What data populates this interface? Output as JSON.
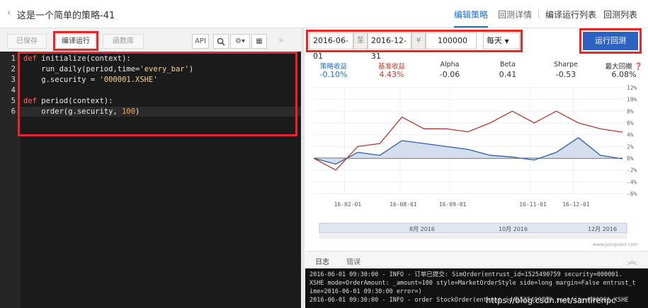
{
  "header": {
    "back": "‹",
    "title": "这是一个简单的策略-41",
    "nav": [
      "编辑策略",
      "回测详情",
      "编译运行列表",
      "回测列表"
    ]
  },
  "toolbar": {
    "tabs": [
      "已保存",
      "编译运行",
      "函数库"
    ],
    "api": "API"
  },
  "editor": {
    "lines": [
      [
        {
          "t": "def ",
          "c": "kw"
        },
        {
          "t": "initialize(context):",
          "c": ""
        }
      ],
      [
        {
          "t": "    run_daily(period,time=",
          "c": ""
        },
        {
          "t": "'every_bar'",
          "c": "str"
        },
        {
          "t": ")",
          "c": ""
        }
      ],
      [
        {
          "t": "    g.security = ",
          "c": ""
        },
        {
          "t": "'000001.XSHE'",
          "c": "str"
        }
      ],
      [],
      [
        {
          "t": "def ",
          "c": "kw"
        },
        {
          "t": "period(context):",
          "c": ""
        }
      ],
      [
        {
          "t": "    order(g.security, ",
          "c": ""
        },
        {
          "t": "100",
          "c": "num"
        },
        {
          "t": ")",
          "c": ""
        }
      ]
    ]
  },
  "backtest": {
    "start": "2016-06-01",
    "to": "至",
    "end": "2016-12-31",
    "currency": "¥",
    "capital": "100000",
    "freq": "每天",
    "run": "运行回测"
  },
  "metrics": [
    {
      "label": "策略收益",
      "value": "-0.10%",
      "color": "#1e6fc1"
    },
    {
      "label": "基准收益",
      "value": "4.43%",
      "color": "#c0392b"
    },
    {
      "label": "Alpha",
      "value": "-0.06",
      "color": "#333"
    },
    {
      "label": "Beta",
      "value": "0.41",
      "color": "#333"
    },
    {
      "label": "Sharpe",
      "value": "-0.53",
      "color": "#333"
    },
    {
      "label": "最大回撤",
      "value": "6.08%",
      "color": "#333"
    }
  ],
  "chart_data": {
    "type": "line",
    "x": [
      "2016-06-01",
      "2016-06-15",
      "2016-07-01",
      "2016-07-15",
      "2016-08-01",
      "2016-08-15",
      "2016-09-01",
      "2016-09-15",
      "2016-10-01",
      "2016-10-15",
      "2016-11-01",
      "2016-11-15",
      "2016-12-01",
      "2016-12-15",
      "2016-12-31"
    ],
    "series": [
      {
        "name": "策略收益",
        "color": "#2f5d9e",
        "values": [
          0,
          -1,
          1,
          0.5,
          3,
          2.5,
          2,
          1.5,
          0.5,
          0.2,
          -0.3,
          1,
          3.5,
          0.5,
          -0.1
        ]
      },
      {
        "name": "基准收益",
        "color": "#b03a2e",
        "values": [
          0,
          -2,
          2,
          2.5,
          7,
          5,
          5,
          4.5,
          6,
          8,
          6,
          8,
          6,
          5,
          4.43
        ]
      }
    ],
    "xticks": [
      "16-02-01",
      "16-08-01",
      "16-09-01",
      "16-11-01",
      "16-12-01"
    ],
    "yticks": [
      "12%",
      "10%",
      "8%",
      "6%",
      "4%",
      "2%",
      "0%",
      "-2%",
      "-4%",
      "-6%"
    ],
    "ylim": [
      -6,
      12
    ],
    "navigator": [
      "8月 2016",
      "10月 2016",
      "12月 2016"
    ],
    "credit": "www.joinquant.com"
  },
  "logs": {
    "tabs": [
      "日志",
      "错误"
    ],
    "lines": [
      "2016-06-01 09:30:00 - INFO - 订单已提交: SimOrder(entrust_id=1525490759 security=000001.",
      "XSHE mode=OrderAmount: _amount=100 style=MarketOrderStyle side=long margin=False entrust_t",
      "ime=2016-06-01 09:30:00 error=)",
      "2016-06-01 09:30:00 - INFO - order StockOrder(entrust_id=1525490759 security=000001.XSHE"
    ]
  },
  "watermark": "https://blog.csdn.net/santirenpc"
}
